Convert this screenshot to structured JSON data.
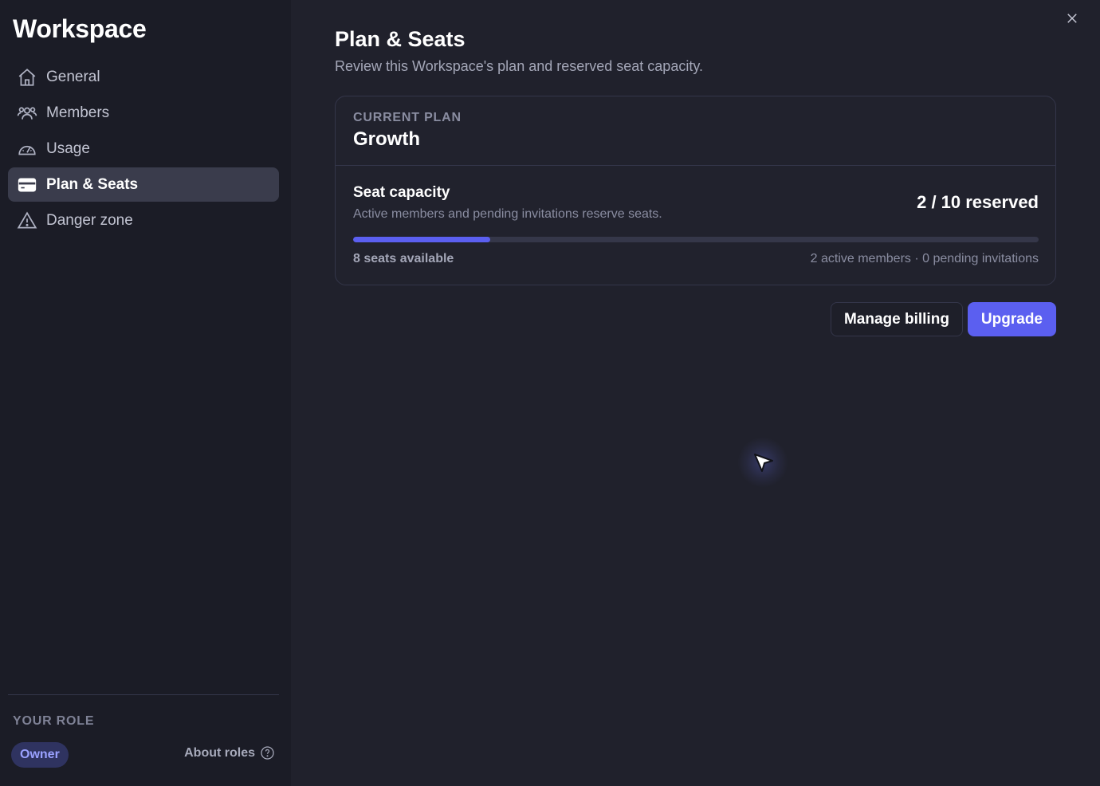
{
  "sidebar": {
    "title": "Workspace",
    "items": [
      {
        "label": "General",
        "icon": "home-icon"
      },
      {
        "label": "Members",
        "icon": "users-icon"
      },
      {
        "label": "Usage",
        "icon": "gauge-icon"
      },
      {
        "label": "Plan & Seats",
        "icon": "credit-card-icon",
        "active": true
      },
      {
        "label": "Danger zone",
        "icon": "warning-icon"
      }
    ],
    "role_label": "YOUR ROLE",
    "role": "Owner",
    "about_roles": "About roles"
  },
  "main": {
    "title": "Plan & Seats",
    "subtitle": "Review this Workspace's plan and reserved seat capacity.",
    "plan": {
      "label": "CURRENT PLAN",
      "name": "Growth"
    },
    "seats": {
      "title": "Seat capacity",
      "description": "Active members and pending invitations reserve seats.",
      "count": "2 / 10 reserved",
      "used": 2,
      "total": 10,
      "available": "8 seats available",
      "meta": "2 active members · 0 pending invitations"
    },
    "buttons": {
      "manage_billing": "Manage billing",
      "upgrade": "Upgrade"
    }
  },
  "colors": {
    "accent": "#5b5ff0",
    "sidebar_bg": "#1b1c26",
    "main_bg": "#20212c"
  }
}
